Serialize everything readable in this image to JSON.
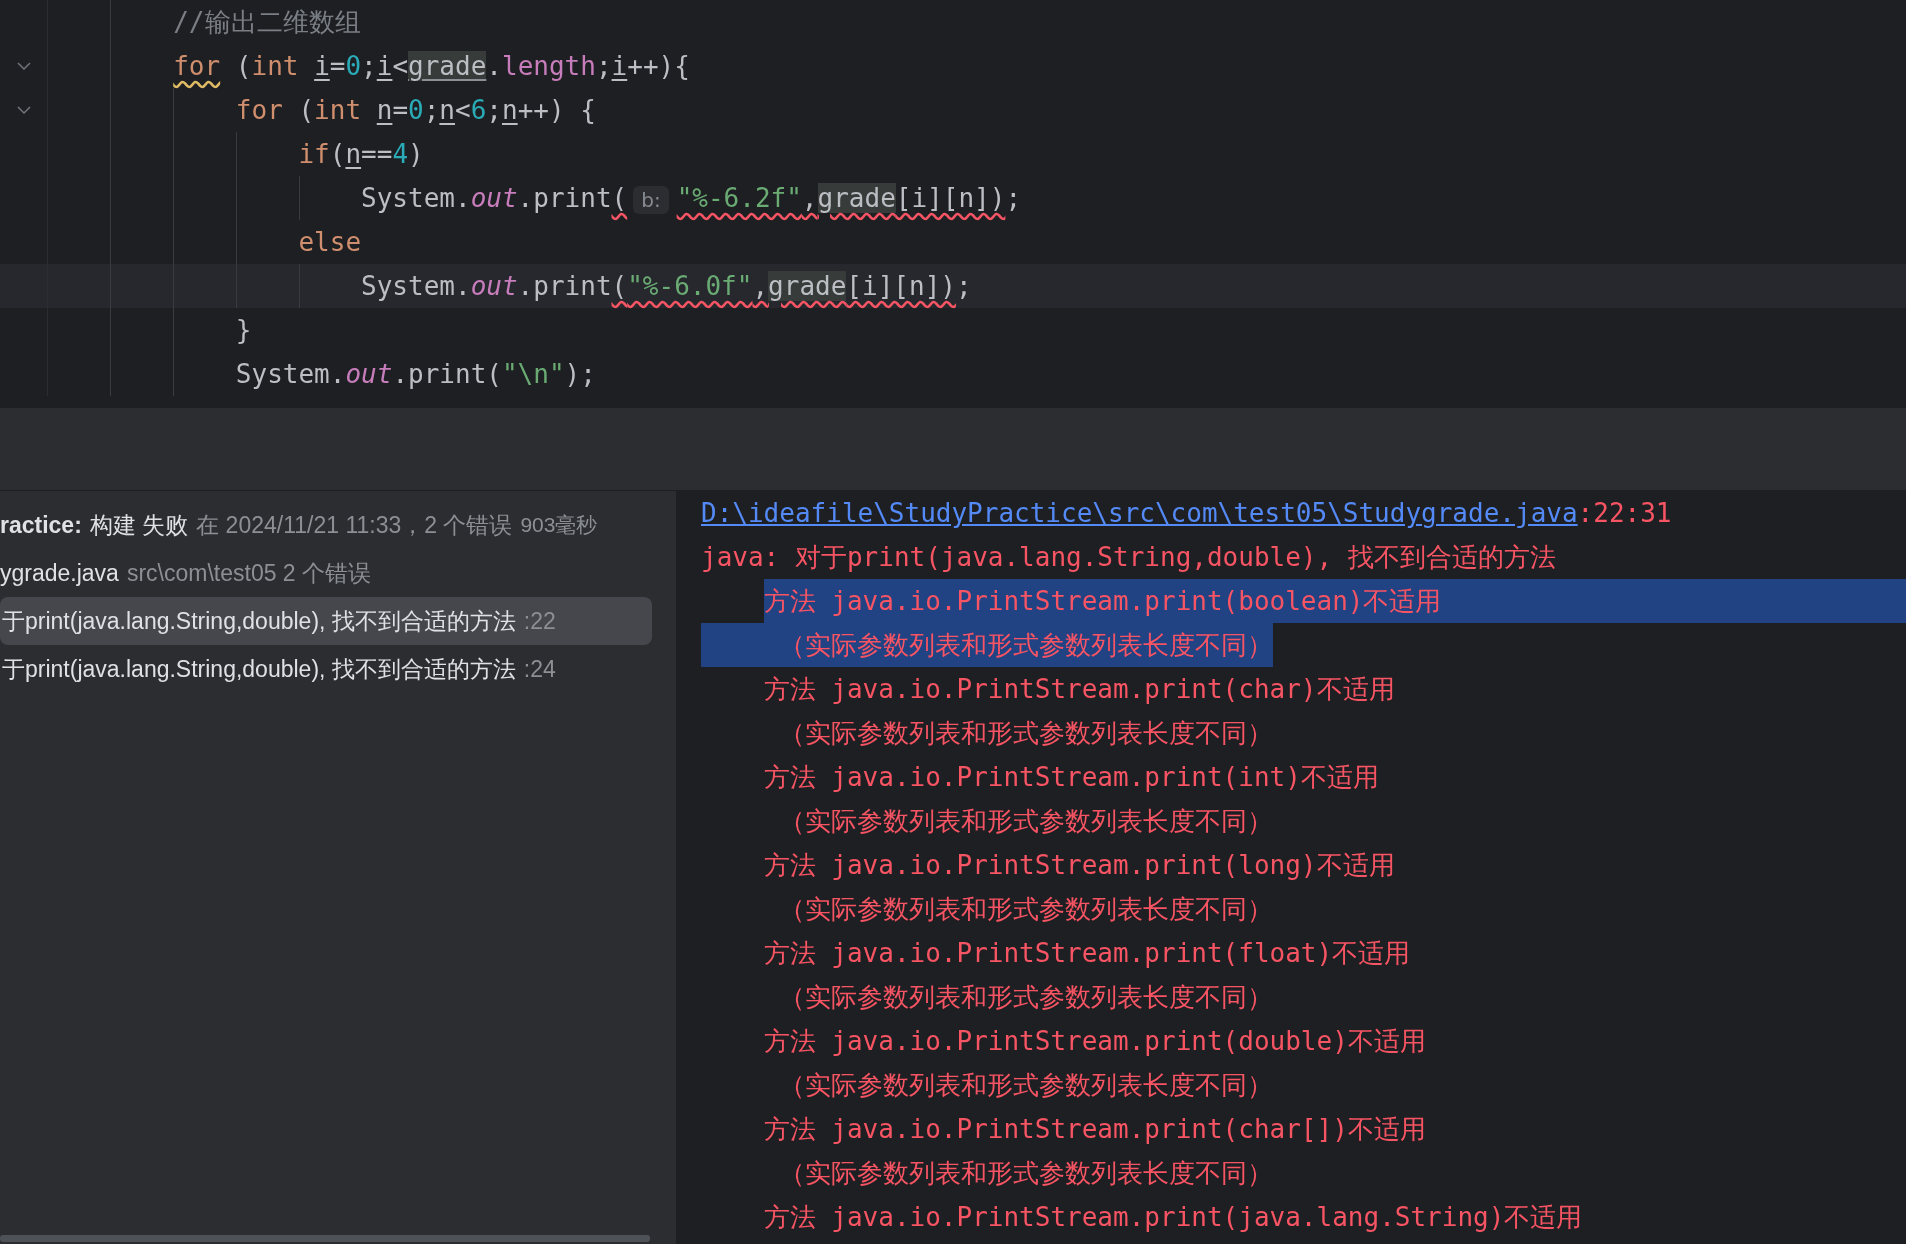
{
  "editor": {
    "lines": [
      {
        "current": false,
        "foldable": false,
        "tokens": [
          {
            "kind": "comment",
            "text": "//输出二维数组"
          }
        ]
      },
      {
        "current": false,
        "foldable": true,
        "tokens": [
          {
            "kind": "warnkeyword",
            "text": "for"
          },
          {
            "kind": "plain",
            "text": " ("
          },
          {
            "kind": "keyword",
            "text": "int "
          },
          {
            "kind": "var",
            "text": "i"
          },
          {
            "kind": "plain",
            "text": "="
          },
          {
            "kind": "number",
            "text": "0"
          },
          {
            "kind": "plain",
            "text": ";"
          },
          {
            "kind": "var",
            "text": "i"
          },
          {
            "kind": "plain",
            "text": "<"
          },
          {
            "kind": "usage",
            "text": "grade"
          },
          {
            "kind": "plain",
            "text": "."
          },
          {
            "kind": "member",
            "text": "length"
          },
          {
            "kind": "plain",
            "text": ";"
          },
          {
            "kind": "var",
            "text": "i"
          },
          {
            "kind": "plain",
            "text": "++){"
          }
        ],
        "children": [
          {
            "current": false,
            "foldable": true,
            "tokens": [
              {
                "kind": "keyword",
                "text": "for"
              },
              {
                "kind": "plain",
                "text": " ("
              },
              {
                "kind": "keyword",
                "text": "int "
              },
              {
                "kind": "var",
                "text": "n"
              },
              {
                "kind": "plain",
                "text": "="
              },
              {
                "kind": "number",
                "text": "0"
              },
              {
                "kind": "plain",
                "text": ";"
              },
              {
                "kind": "var",
                "text": "n"
              },
              {
                "kind": "plain",
                "text": "<"
              },
              {
                "kind": "number",
                "text": "6"
              },
              {
                "kind": "plain",
                "text": ";"
              },
              {
                "kind": "var",
                "text": "n"
              },
              {
                "kind": "plain",
                "text": "++) {"
              }
            ],
            "children": [
              {
                "current": false,
                "foldable": false,
                "tokens": [
                  {
                    "kind": "keyword",
                    "text": "if"
                  },
                  {
                    "kind": "plain",
                    "text": "("
                  },
                  {
                    "kind": "var",
                    "text": "n"
                  },
                  {
                    "kind": "plain",
                    "text": "=="
                  },
                  {
                    "kind": "number",
                    "text": "4"
                  },
                  {
                    "kind": "plain",
                    "text": ")"
                  }
                ],
                "children": [
                  {
                    "current": false,
                    "foldable": false,
                    "tokens": [
                      {
                        "kind": "plain",
                        "text": "System."
                      },
                      {
                        "kind": "static",
                        "text": "out"
                      },
                      {
                        "kind": "plain",
                        "text": ".print"
                      },
                      {
                        "kind": "errplain",
                        "text": "("
                      },
                      {
                        "kind": "hint",
                        "text": "b:"
                      },
                      {
                        "kind": "errstring",
                        "text": "\"%-6.2f\""
                      },
                      {
                        "kind": "errplain",
                        "text": ","
                      },
                      {
                        "kind": "errusage",
                        "text": "grade"
                      },
                      {
                        "kind": "errplain",
                        "text": "[i][n])"
                      },
                      {
                        "kind": "plain",
                        "text": ";"
                      }
                    ]
                  }
                ]
              },
              {
                "current": false,
                "foldable": false,
                "tokens": [
                  {
                    "kind": "keyword",
                    "text": "else"
                  }
                ],
                "children": [
                  {
                    "current": true,
                    "foldable": false,
                    "tokens": [
                      {
                        "kind": "plain",
                        "text": "System."
                      },
                      {
                        "kind": "static",
                        "text": "out"
                      },
                      {
                        "kind": "plain",
                        "text": ".print"
                      },
                      {
                        "kind": "errplain",
                        "text": "("
                      },
                      {
                        "kind": "errstring",
                        "text": "\"%-6.0f\""
                      },
                      {
                        "kind": "errplain",
                        "text": ","
                      },
                      {
                        "kind": "errusage",
                        "text": "grade"
                      },
                      {
                        "kind": "errplain",
                        "text": "[i][n])"
                      },
                      {
                        "kind": "plain",
                        "text": ";"
                      }
                    ]
                  }
                ]
              }
            ]
          },
          {
            "current": false,
            "foldable": false,
            "tokens": [
              {
                "kind": "plain",
                "text": "}"
              }
            ]
          },
          {
            "current": false,
            "foldable": false,
            "tokens": [
              {
                "kind": "plain",
                "text": "System."
              },
              {
                "kind": "static",
                "text": "out"
              },
              {
                "kind": "plain",
                "text": ".print("
              },
              {
                "kind": "string",
                "text": "\"\\n\""
              },
              {
                "kind": "plain",
                "text": ");"
              }
            ]
          }
        ]
      }
    ]
  },
  "build_tree": [
    {
      "kind": "build",
      "selected": false,
      "project": "ractice:",
      "status": "构建 失败",
      "detail": "在 2024/11/21 11:33，2 个错误",
      "duration": "903毫秒"
    },
    {
      "kind": "file",
      "selected": false,
      "name": "ygrade.java",
      "detail": "src\\com\\test05 2 个错误"
    },
    {
      "kind": "error",
      "selected": true,
      "message": "于print(java.lang.String,double), 找不到合适的方法",
      "line": ":22"
    },
    {
      "kind": "error",
      "selected": false,
      "message": "于print(java.lang.String,double), 找不到合适的方法",
      "line": ":24"
    }
  ],
  "console": [
    {
      "kind": "location",
      "selected": false,
      "link": "D:\\ideafile\\StudyPractice\\src\\com\\test05\\Studygrade.java",
      "text": ":22:31"
    },
    {
      "kind": "message",
      "selected": false,
      "text": "java: 对于print(java.lang.String,double), 找不到合适的方法"
    },
    {
      "kind": "candidate",
      "selected": true,
      "text": "方法 java.io.PrintStream.print(boolean)不适用"
    },
    {
      "kind": "reason",
      "selected": true,
      "text": "（实际参数列表和形式参数列表长度不同）"
    },
    {
      "kind": "candidate",
      "selected": false,
      "text": "方法 java.io.PrintStream.print(char)不适用"
    },
    {
      "kind": "reason",
      "selected": false,
      "text": "（实际参数列表和形式参数列表长度不同）"
    },
    {
      "kind": "candidate",
      "selected": false,
      "text": "方法 java.io.PrintStream.print(int)不适用"
    },
    {
      "kind": "reason",
      "selected": false,
      "text": "（实际参数列表和形式参数列表长度不同）"
    },
    {
      "kind": "candidate",
      "selected": false,
      "text": "方法 java.io.PrintStream.print(long)不适用"
    },
    {
      "kind": "reason",
      "selected": false,
      "text": "（实际参数列表和形式参数列表长度不同）"
    },
    {
      "kind": "candidate",
      "selected": false,
      "text": "方法 java.io.PrintStream.print(float)不适用"
    },
    {
      "kind": "reason",
      "selected": false,
      "text": "（实际参数列表和形式参数列表长度不同）"
    },
    {
      "kind": "candidate",
      "selected": false,
      "text": "方法 java.io.PrintStream.print(double)不适用"
    },
    {
      "kind": "reason",
      "selected": false,
      "text": "（实际参数列表和形式参数列表长度不同）"
    },
    {
      "kind": "candidate",
      "selected": false,
      "text": "方法 java.io.PrintStream.print(char[])不适用"
    },
    {
      "kind": "reason",
      "selected": false,
      "text": "（实际参数列表和形式参数列表长度不同）"
    },
    {
      "kind": "candidate",
      "selected": false,
      "text": "方法 java.io.PrintStream.print(java.lang.String)不适用"
    }
  ]
}
